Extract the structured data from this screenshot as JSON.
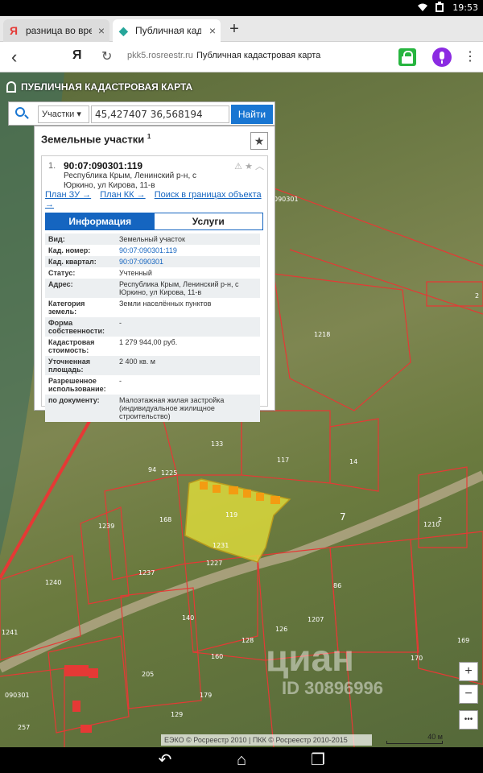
{
  "status_bar": {
    "time": "19:53"
  },
  "tabs": [
    {
      "icon": "Я",
      "title": "разница во врем",
      "close": "×"
    },
    {
      "icon": "◆",
      "title": "Публичная кадас",
      "close": "×"
    }
  ],
  "new_tab": "+",
  "address_bar": {
    "back": "‹",
    "yandex": "Я",
    "reload": "↻",
    "url": "pkk5.rosreestr.ru",
    "title": "Публичная кадастровая карта",
    "menu": "⋮"
  },
  "map_header": {
    "title": "ПУБЛИЧНАЯ КАДАСТРОВАЯ КАРТА"
  },
  "search": {
    "select": "Участки ▾",
    "query": "45,427407 36,568194",
    "button": "Найти"
  },
  "panel": {
    "title": "Земельные участки",
    "count_sup": "1",
    "star": "★",
    "item": {
      "index": "1.",
      "cad_number": "90:07:090301:119",
      "address": "Республика Крым, Ленинский р-н, с Юркино, ул Кирова, 11-в",
      "icons": "⚠ ★ ︿",
      "links": [
        "План ЗУ →",
        "План КК →",
        "Поиск в границах объекта →"
      ]
    },
    "tabs": {
      "info": "Информация",
      "services": "Услуги"
    },
    "rows": [
      {
        "k": "Вид:",
        "v": "Земельный участок",
        "link": false
      },
      {
        "k": "Кад. номер:",
        "v": "90:07:090301:119",
        "link": true
      },
      {
        "k": "Кад. квартал:",
        "v": "90:07:090301",
        "link": true
      },
      {
        "k": "Статус:",
        "v": "Учтенный",
        "link": false
      },
      {
        "k": "Адрес:",
        "v": "Республика Крым, Ленинский р-н, с Юркино, ул Кирова, 11-в",
        "link": false
      },
      {
        "k": "Категория земель:",
        "v": "Земли населённых пунктов",
        "link": false
      },
      {
        "k": "Форма собственности:",
        "v": "-",
        "link": false
      },
      {
        "k": "Кадастровая стоимость:",
        "v": "1 279 944,00 руб.",
        "link": false
      },
      {
        "k": "Уточненная площадь:",
        "v": "2 400 кв. м",
        "link": false
      },
      {
        "k": "Разрешенное использование:",
        "v": "-",
        "link": false
      },
      {
        "k": "по документу:",
        "v": "Малоэтажная жилая застройка (индивидуальное жилищное строительство)",
        "link": false
      }
    ]
  },
  "map_labels": [
    "090301",
    "1218",
    "133",
    "117",
    "14",
    "94",
    "1225",
    "1239",
    "168",
    "119",
    "1231",
    "1237",
    "1240",
    "1241",
    "86",
    "1207",
    "126",
    "128",
    "160",
    "140",
    "205",
    "129",
    "179",
    "170",
    "169",
    "1210",
    "2",
    "090301",
    "257",
    "7",
    "2",
    "1227"
  ],
  "controls": {
    "zoom_in": "+",
    "zoom_out": "−",
    "more": "•••"
  },
  "copyright": "ЕЭКО © Росреестр 2010 | ПКК © Росреестр 2010-2015",
  "scale": "40 м",
  "watermark": {
    "brand": "циан",
    "id": "ID 30896996"
  },
  "nav": {
    "back": "↶",
    "home": "⌂",
    "recent": "❐"
  }
}
